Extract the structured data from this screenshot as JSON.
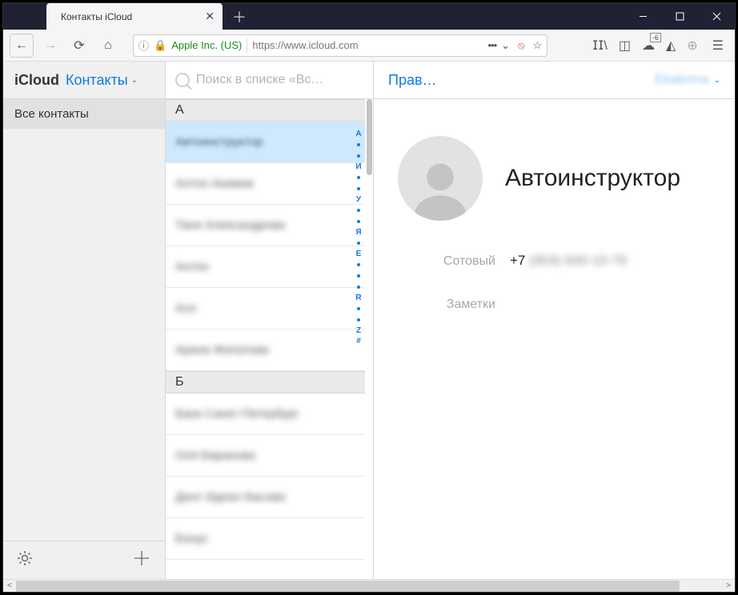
{
  "browser": {
    "tab_title": "Контакты iCloud",
    "url_owner": "Apple Inc. (US)",
    "url": "https://www.icloud.com",
    "sync_badge": "-6"
  },
  "header": {
    "brand": "iCloud",
    "section": "Контакты",
    "search_placeholder": "Поиск в списке «Вс…",
    "edit_label": "Прав…",
    "user_display": "Ekaterina"
  },
  "sidebar": {
    "all_contacts": "Все контакты"
  },
  "list": {
    "sections": [
      {
        "letter": "А",
        "rows": [
          "Автоинструктор",
          "Антон Акимов",
          "Таня Александрова",
          "Антон",
          "Ася",
          "Арина Жигалова"
        ]
      },
      {
        "letter": "Б",
        "rows": [
          "Банк Санкт-Петербург",
          "Оля Баранова",
          "Дент Идеал Басова",
          "Бонус"
        ]
      }
    ],
    "selected_index": [
      0,
      0
    ]
  },
  "index_strip": [
    "А",
    "•",
    "•",
    "И",
    "•",
    "•",
    "У",
    "•",
    "•",
    "Я",
    "•",
    "Е",
    "•",
    "•",
    "•",
    "R",
    "•",
    "•",
    "Z",
    "#"
  ],
  "detail": {
    "name": "Автоинструктор",
    "phone_label": "Сотовый",
    "phone_prefix": "+7",
    "phone_rest": "(904) 640-10-76",
    "notes_label": "Заметки"
  }
}
